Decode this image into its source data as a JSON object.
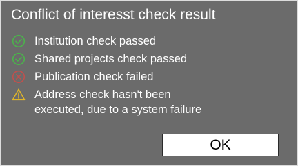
{
  "dialog": {
    "title": "Conflict of interesst check result",
    "checks": [
      {
        "label": "Institution check passed",
        "icon": "check-circle-icon",
        "status": "passed",
        "color": "#4bb34b"
      },
      {
        "label": "Shared projects check passed",
        "icon": "check-circle-icon",
        "status": "passed",
        "color": "#4bb34b"
      },
      {
        "label": "Publication check failed",
        "icon": "cross-circle-icon",
        "status": "failed",
        "color": "#c0504d"
      },
      {
        "label": "Address check hasn't been\nexecuted, due to a system failure",
        "icon": "warning-triangle-icon",
        "status": "warning",
        "color": "#e0b52a"
      }
    ],
    "ok_label": "OK"
  }
}
